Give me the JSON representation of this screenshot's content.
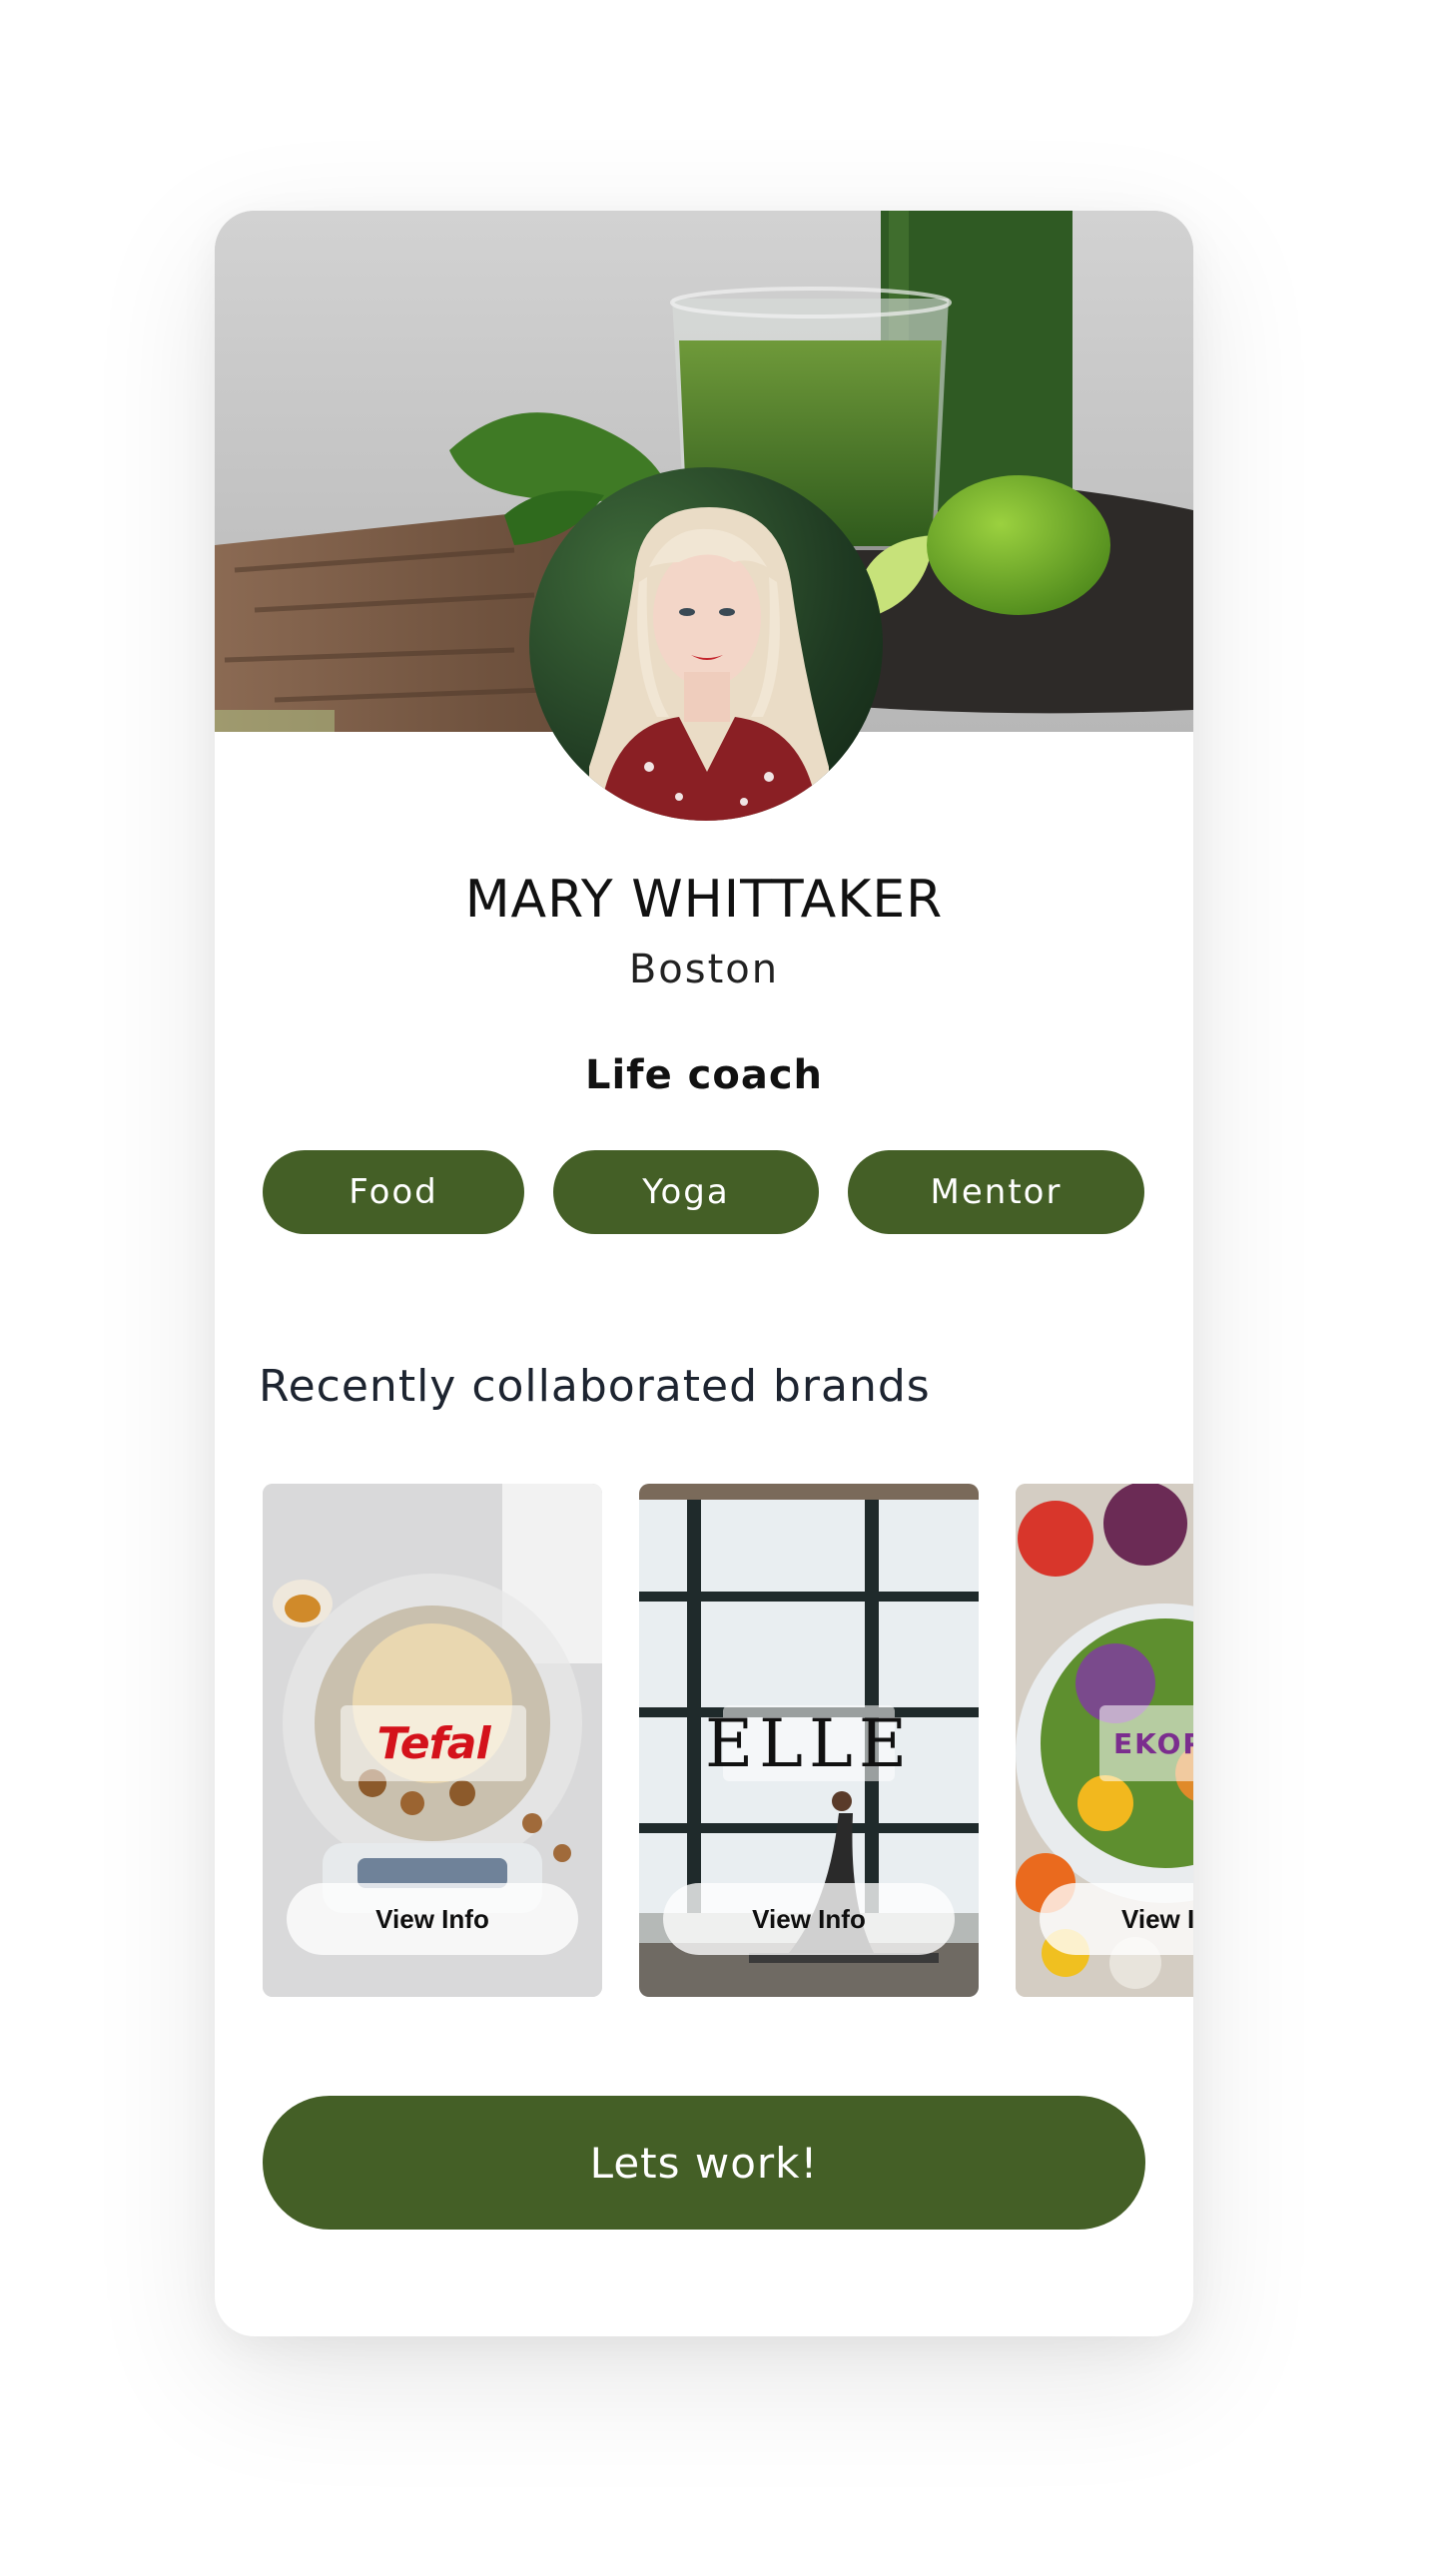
{
  "profile": {
    "name": "MARY WHITTAKER",
    "city": "Boston",
    "role": "Life coach",
    "cover_image": "green-smoothie-cover",
    "avatar_image": "portrait-avatar"
  },
  "tags": [
    {
      "label": "Food"
    },
    {
      "label": "Yoga"
    },
    {
      "label": "Mentor"
    }
  ],
  "brands_section": {
    "title": "Recently collaborated brands",
    "items": [
      {
        "brand": "Tefal",
        "button_label": "View Info",
        "logo_color": "#d4121b"
      },
      {
        "brand": "ELLE",
        "button_label": "View Info",
        "logo_color": "#111111"
      },
      {
        "brand": "EKOPL",
        "button_label": "View I",
        "logo_color": "#7b2d8e"
      }
    ]
  },
  "cta": {
    "label": "Lets work!"
  },
  "colors": {
    "accent": "#445f26",
    "heading": "#111111",
    "section_title": "#1d2430",
    "card_background": "#ffffff"
  }
}
